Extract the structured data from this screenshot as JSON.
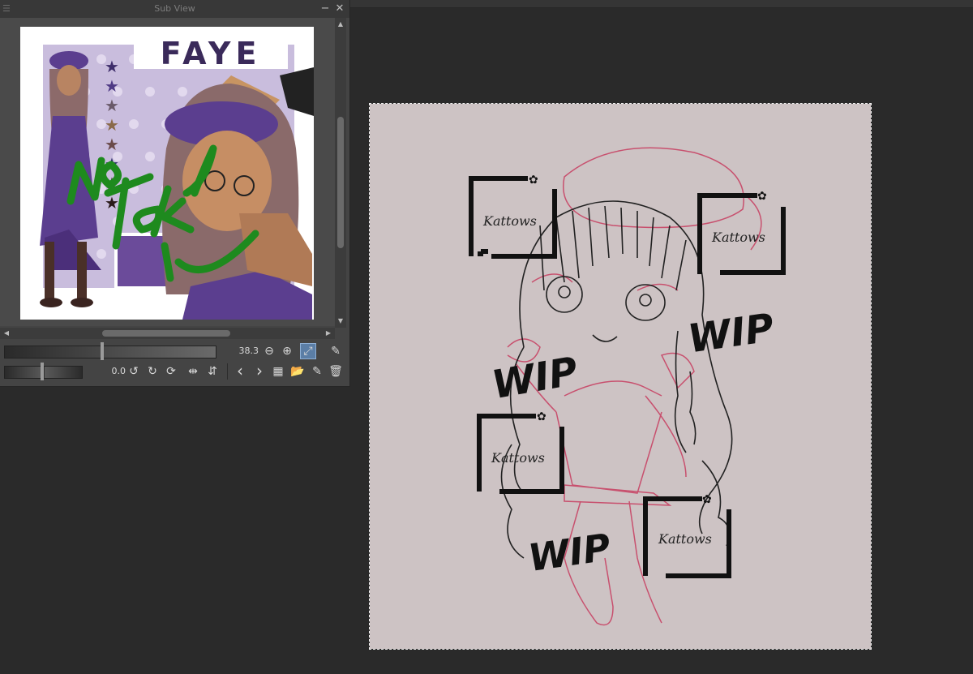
{
  "panel": {
    "title": "Sub View",
    "zoom_value": "38.3",
    "rotation_value": "0.0",
    "buttons": {
      "menu": "☰",
      "minimize": "−",
      "close": "✕",
      "zoom_out": "⊖",
      "zoom_in": "⊕",
      "fit": "⤢",
      "eyedropper": "✎",
      "rotate_left": "↺",
      "rotate_right": "↻",
      "reset_rotation": "⟳",
      "flip_horizontal": "⇹",
      "flip_vertical": "⇵",
      "previous": "‹",
      "next": "›",
      "grid": "▦",
      "open": "📂",
      "edit": "✎",
      "delete": "🗑"
    }
  },
  "reference_image": {
    "title_text": "FAYE",
    "overlay_text": "No Take",
    "colors": {
      "purple": "#5b3e8f",
      "light_purple": "#c9bddd",
      "green": "#1e8a1e"
    }
  },
  "canvas": {
    "wip_labels": [
      "WIP",
      "WIP",
      "WIP"
    ],
    "watermark_text": "Kattows",
    "colors": {
      "background": "#cdc3c4",
      "sketch_pink": "#c8506e",
      "lineart": "#222222"
    }
  }
}
